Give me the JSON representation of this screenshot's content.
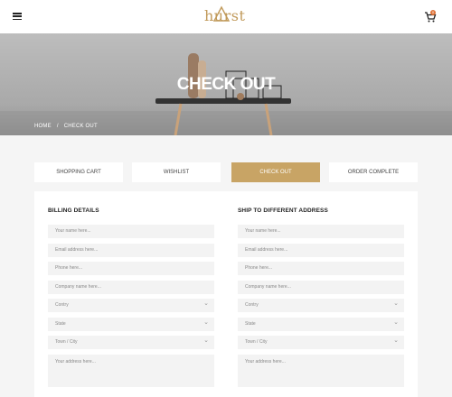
{
  "header": {
    "logo_text": "hurst",
    "cart_count": "0",
    "brand_color": "#c19a5b"
  },
  "hero": {
    "title": "CHECK OUT",
    "breadcrumb": {
      "home": "HOME",
      "separator": "/",
      "current": "CHECK OUT"
    }
  },
  "tabs": [
    {
      "label": "SHOPPING CART",
      "active": false
    },
    {
      "label": "WISHLIST",
      "active": false
    },
    {
      "label": "CHECK OUT",
      "active": true
    },
    {
      "label": "ORDER COMPLETE",
      "active": false
    }
  ],
  "billing": {
    "title": "BILLING DETAILS",
    "name_placeholder": "Your name here...",
    "email_placeholder": "Email address here...",
    "phone_placeholder": "Phone here...",
    "company_placeholder": "Company name here...",
    "country": "Contry",
    "state": "State",
    "town": "Town / City",
    "address_placeholder": "Your address here..."
  },
  "shipping": {
    "title": "SHIP TO DIFFERENT ADDRESS",
    "name_placeholder": "Your name here...",
    "email_placeholder": "Email address here...",
    "phone_placeholder": "Phone here...",
    "company_placeholder": "Company name here...",
    "country": "Contry",
    "state": "State",
    "town": "Town / City",
    "address_placeholder": "Your address here..."
  },
  "colors": {
    "accent": "#c8a465",
    "badge": "#e0743a"
  }
}
